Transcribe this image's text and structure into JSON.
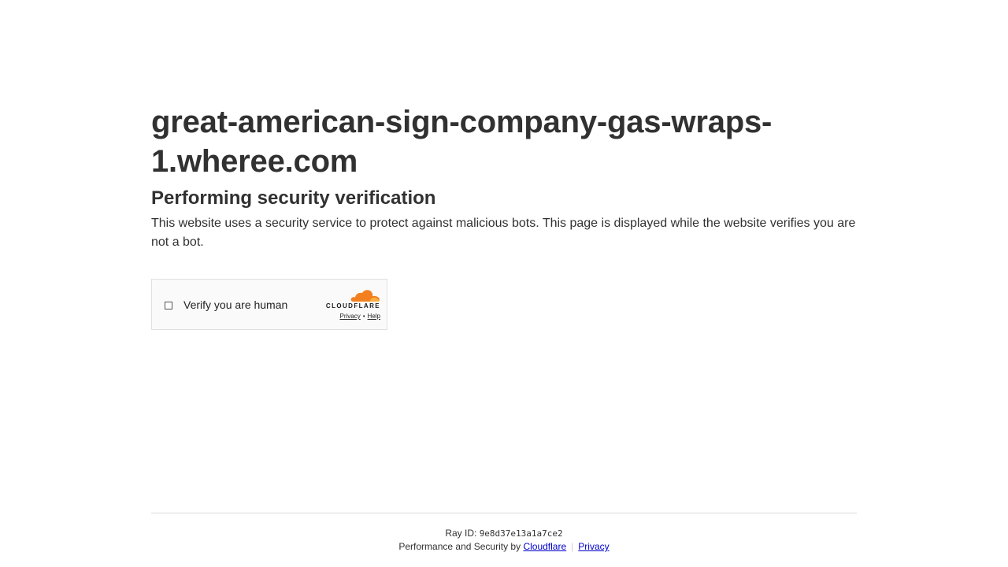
{
  "page": {
    "domain": "great-american-sign-company-gas-wraps-1.wheree.com",
    "heading": "Performing security verification",
    "description": "This website uses a security service to protect against malicious bots. This page is displayed while the website verifies you are not a bot."
  },
  "widget": {
    "checkbox_checked": false,
    "label": "Verify you are human",
    "brand": "CLOUDFLARE",
    "privacy_link": "Privacy",
    "separator": "•",
    "help_link": "Help",
    "brand_color": "#f38020",
    "brand_color_light": "#faae40"
  },
  "footer": {
    "ray_label": "Ray ID:",
    "ray_id": "9e8d37e13a1a7ce2",
    "performance_text": "Performance and Security by",
    "cloudflare_link": "Cloudflare",
    "divider": "|",
    "privacy_link": "Privacy",
    "link_color": "#0000cc"
  }
}
